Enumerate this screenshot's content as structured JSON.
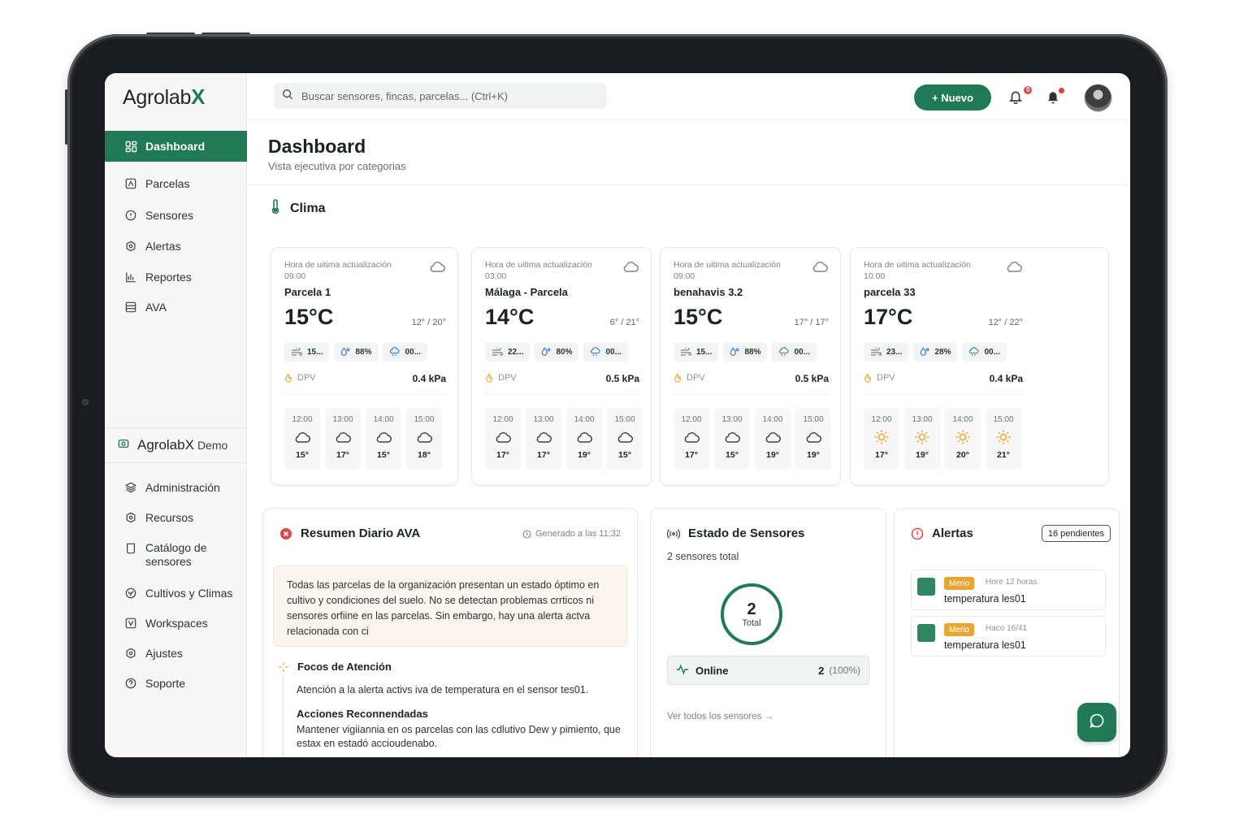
{
  "brand": {
    "name": "Agrolab",
    "mark": "X"
  },
  "search": {
    "placeholder": "Buscar sensores, fincas, parcelas... (Ctrl+K)"
  },
  "topbar": {
    "new_label": "+ Nuevo",
    "notif_badge": "0"
  },
  "sidebar": {
    "items": [
      {
        "label": "Dashboard",
        "icon": "dashboard-icon",
        "active": true
      },
      {
        "label": "Parcelas",
        "icon": "map-icon"
      },
      {
        "label": "Sensores",
        "icon": "sensor-icon"
      },
      {
        "label": "Alertas",
        "icon": "alert-icon"
      },
      {
        "label": "Reportes",
        "icon": "chart-icon"
      },
      {
        "label": "AVA",
        "icon": "ava-icon"
      }
    ],
    "org": {
      "name": "AgrolabX",
      "suffix": "Demo"
    },
    "admin_items": [
      {
        "label": "Administración",
        "icon": "layers-icon"
      },
      {
        "label": "Recursos",
        "icon": "resources-icon"
      },
      {
        "label": "Catálogo de sensores",
        "icon": "catalog-icon"
      },
      {
        "label": "Cultivos y Climas",
        "icon": "crops-icon"
      },
      {
        "label": "Workspaces",
        "icon": "workspaces-icon"
      },
      {
        "label": "Ajustes",
        "icon": "settings-icon"
      },
      {
        "label": "Soporte",
        "icon": "support-icon"
      }
    ]
  },
  "page": {
    "title": "Dashboard",
    "subtitle": "Vista ejecutiva por categorias"
  },
  "climate": {
    "title": "Clima",
    "cards": [
      {
        "updated_label": "Hora de uitima actualización",
        "updated_time": "09:00",
        "name": "Parcela 1",
        "temp": "15°C",
        "range": "12° / 20°",
        "chips": [
          "15...",
          "88%",
          "00..."
        ],
        "dpv_label": "DPV",
        "dpv_value": "0.4 kPa",
        "hours": [
          {
            "t": "12:00",
            "v": "15°",
            "i": "cloud"
          },
          {
            "t": "13:00",
            "v": "17°",
            "i": "cloud"
          },
          {
            "t": "14:00",
            "v": "15°",
            "i": "cloud"
          },
          {
            "t": "15:00",
            "v": "18°",
            "i": "cloud"
          }
        ]
      },
      {
        "updated_label": "Hora de uitima actualización",
        "updated_time": "03:00",
        "name": "Málaga - Parcela",
        "temp": "14°C",
        "range": "6° / 21°",
        "chips": [
          "22...",
          "80%",
          "00..."
        ],
        "dpv_label": "DPV",
        "dpv_value": "0.5 kPa",
        "hours": [
          {
            "t": "12:00",
            "v": "17°",
            "i": "cloud"
          },
          {
            "t": "13:00",
            "v": "17°",
            "i": "cloud"
          },
          {
            "t": "14:00",
            "v": "19°",
            "i": "cloud"
          },
          {
            "t": "15:00",
            "v": "15°",
            "i": "cloud"
          }
        ]
      },
      {
        "updated_label": "Hora de uitima actualización",
        "updated_time": "09:00",
        "name": "benahavis 3.2",
        "temp": "15°C",
        "range": "17° / 17°",
        "chips": [
          "15...",
          "88%",
          "00..."
        ],
        "dpv_label": "DPV",
        "dpv_value": "0.5 kPa",
        "hours": [
          {
            "t": "12:00",
            "v": "17°",
            "i": "cloud"
          },
          {
            "t": "13:00",
            "v": "15°",
            "i": "cloud"
          },
          {
            "t": "14:00",
            "v": "19°",
            "i": "cloud"
          },
          {
            "t": "15:00",
            "v": "19°",
            "i": "cloud"
          }
        ]
      },
      {
        "updated_label": "Hora de uitima actualización",
        "updated_time": "10:00",
        "name": "parcela 33",
        "temp": "17°C",
        "range": "12° / 22°",
        "chips": [
          "23...",
          "28%",
          "00..."
        ],
        "dpv_label": "DPV",
        "dpv_value": "0.4 kPa",
        "hours": [
          {
            "t": "12:00",
            "v": "17°",
            "i": "sun"
          },
          {
            "t": "13:00",
            "v": "19°",
            "i": "sun"
          },
          {
            "t": "14:00",
            "v": "20°",
            "i": "sun"
          },
          {
            "t": "15:00",
            "v": "21°",
            "i": "sun"
          }
        ]
      }
    ]
  },
  "ava": {
    "title": "Resumen Diario AVA",
    "generated": "Generado a las 11:32",
    "summary": "Todas las parcelas de la organización presentan un estado óptimo en cultivo y condiciones del suelo. No se detectan problemas crrticos ni sensores orfiine en las parcelas. Sin embargo, hay una alerta actva relacionada con ci",
    "focus_title": "Focos de Atención",
    "focus_text": "Atención a la alerta activs iva de temperatura en el sensor tes01.",
    "actions_title": "Acciones Reconnendadas",
    "actions_text": "Mantener vigiiannia en os parcelas con las cdlutivo Dew y pimiento, que estax en estadó accioudenabo."
  },
  "sensors": {
    "title": "Estado de Sensores",
    "count_text": "2 sensores total",
    "total_value": "2",
    "total_label": "Total",
    "online_label": "Online",
    "online_count": "2",
    "online_pct": "(100%)",
    "see_all": "Ver todos los sensores →"
  },
  "alerts": {
    "title": "Alertas",
    "pending": "16 pendientes",
    "items": [
      {
        "tag": "Merio",
        "time": "Hore 12 horas",
        "text": "temperatura les01"
      },
      {
        "tag": "Merio",
        "time": "Haco 16/41",
        "text": "temperatura les01"
      }
    ]
  },
  "colors": {
    "brand_green": "#1f7a55",
    "warning": "#e8a531",
    "danger": "#e04848"
  }
}
